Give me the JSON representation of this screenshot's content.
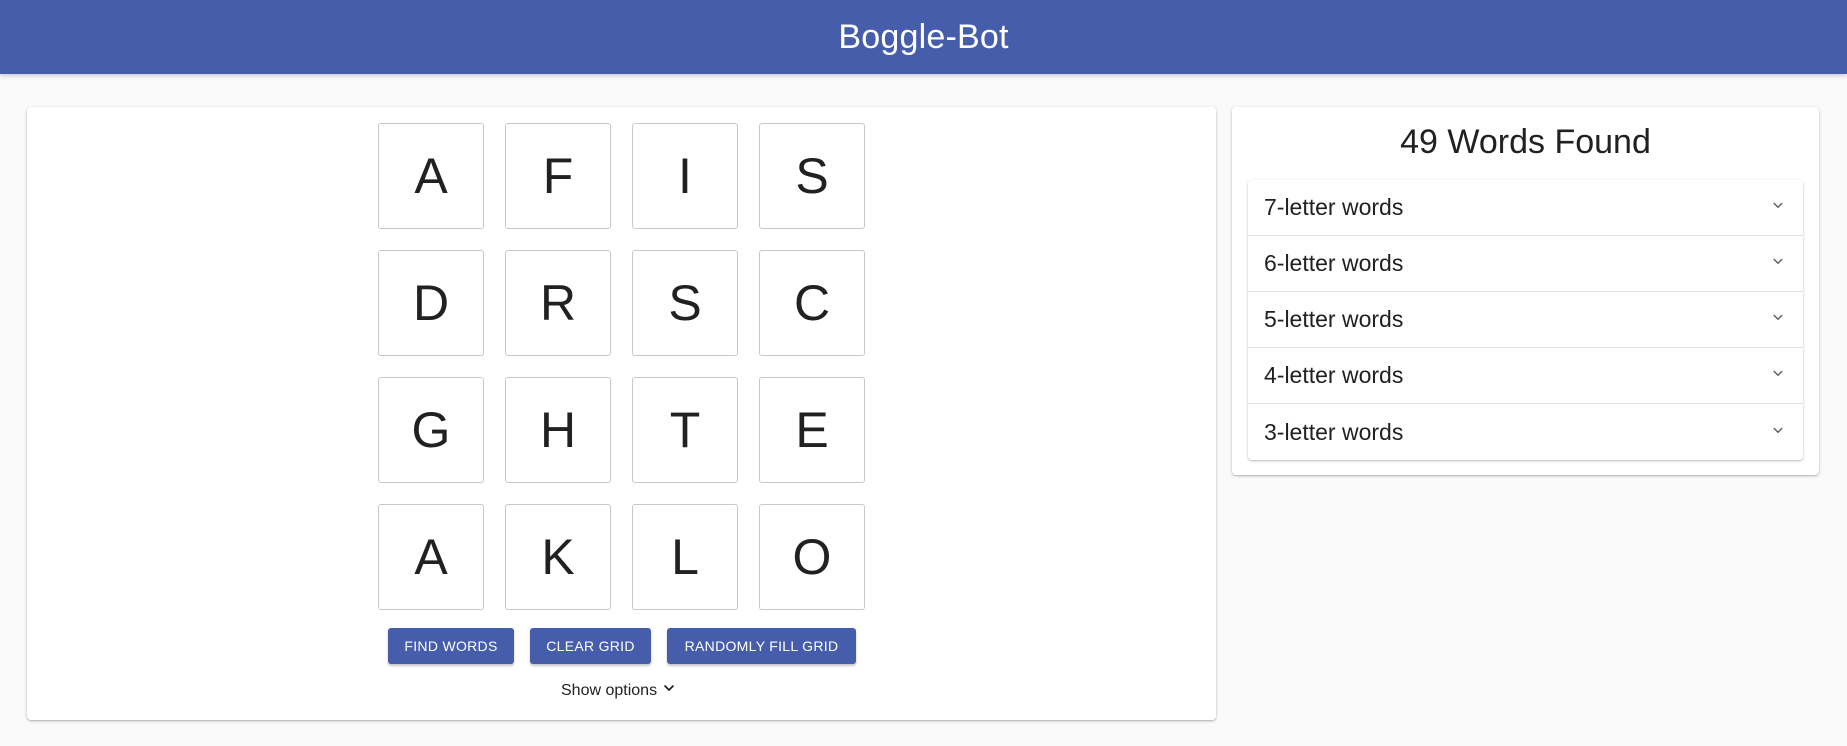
{
  "header": {
    "title": "Boggle-Bot",
    "color": "#465dab"
  },
  "grid": {
    "tiles": [
      "A",
      "F",
      "I",
      "S",
      "D",
      "R",
      "S",
      "C",
      "G",
      "H",
      "T",
      "E",
      "A",
      "K",
      "L",
      "O"
    ]
  },
  "buttons": {
    "find": "FIND WORDS",
    "clear": "CLEAR GRID",
    "random": "RANDOMLY FILL GRID"
  },
  "options": {
    "label": "Show options",
    "icon": "chevron-down-icon"
  },
  "results": {
    "title": "49 Words Found",
    "groups": [
      {
        "label": "7-letter words",
        "icon": "chevron-down-icon"
      },
      {
        "label": "6-letter words",
        "icon": "chevron-down-icon"
      },
      {
        "label": "5-letter words",
        "icon": "chevron-down-icon"
      },
      {
        "label": "4-letter words",
        "icon": "chevron-down-icon"
      },
      {
        "label": "3-letter words",
        "icon": "chevron-down-icon"
      }
    ]
  }
}
